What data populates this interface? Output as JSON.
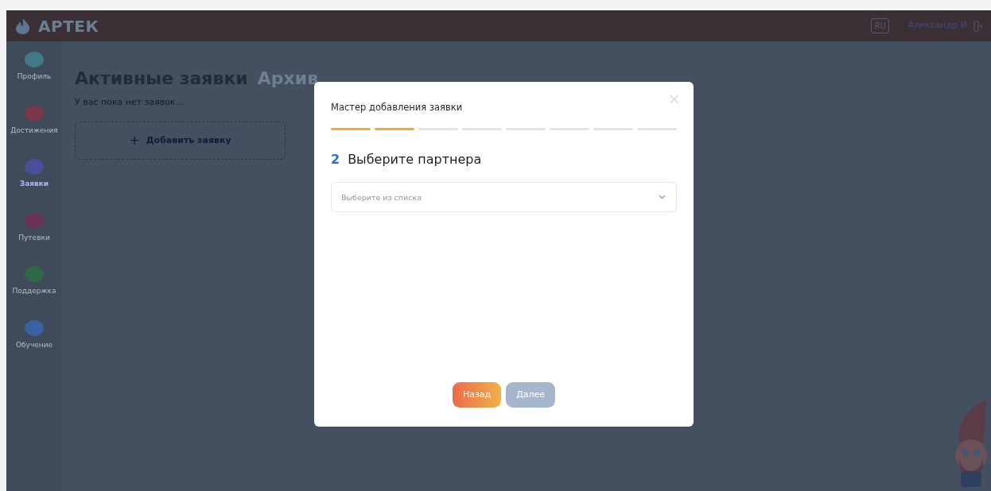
{
  "header": {
    "logo": "АРТЕК",
    "language": "RU",
    "user": "Александр И"
  },
  "sidebar": {
    "items": [
      {
        "label": "Профиль",
        "selected": false,
        "color": "#3f7a86"
      },
      {
        "label": "Достижения",
        "selected": false,
        "color": "#7a3848"
      },
      {
        "label": "Заявки",
        "selected": true,
        "color": "#4a4f9a"
      },
      {
        "label": "Путевки",
        "selected": false,
        "color": "#6a3258"
      },
      {
        "label": "Поддержка",
        "selected": false,
        "color": "#2f6a48"
      },
      {
        "label": "Обучение",
        "selected": false,
        "color": "#3a62a0"
      }
    ]
  },
  "page": {
    "tabs": [
      {
        "label": "Активные заявки",
        "selected": true
      },
      {
        "label": "Архив",
        "selected": false
      }
    ],
    "empty_message": "У вас пока нет заявок...",
    "add_button": "Добавить заявку",
    "add_icon": "+"
  },
  "modal": {
    "title": "Мастер добавления заявки",
    "close": "×",
    "steps": [
      {
        "completed": true
      },
      {
        "completed": true
      },
      {
        "completed": false
      },
      {
        "completed": false
      },
      {
        "completed": false
      },
      {
        "completed": false
      },
      {
        "completed": false
      },
      {
        "completed": false
      }
    ],
    "step_number": "2",
    "step_title": "Выберите партнера",
    "select": {
      "placeholder": "Выберите из списка"
    },
    "buttons": [
      {
        "label": "Назад",
        "kind": "back",
        "disabled": false
      },
      {
        "label": "Далее",
        "kind": "next",
        "disabled": true
      }
    ]
  }
}
